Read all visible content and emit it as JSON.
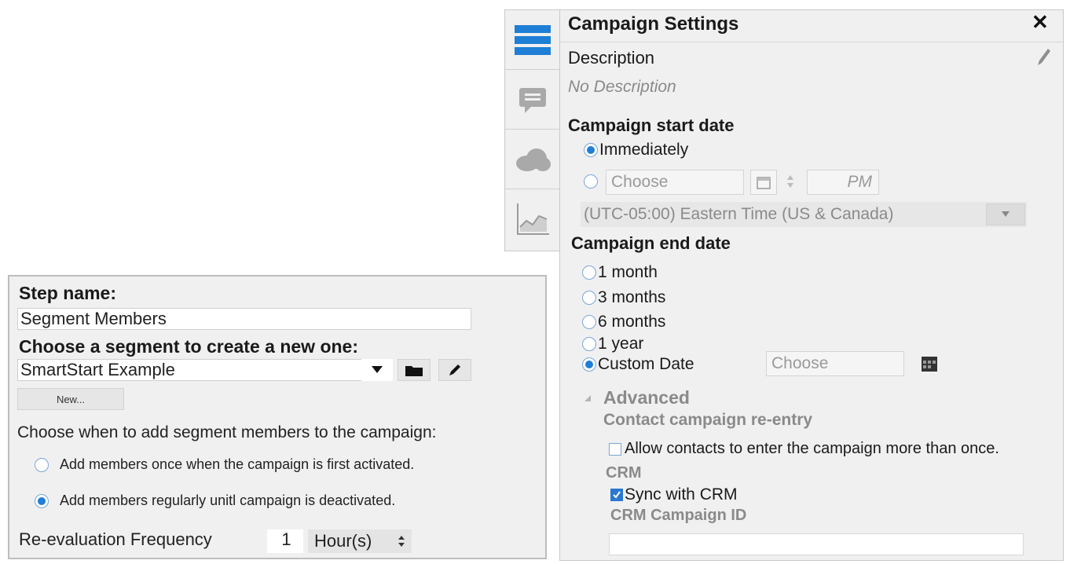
{
  "segment_step": {
    "step_name_label": "Step name:",
    "step_name_value": "Segment Members",
    "segment_label": "Choose a segment to create a new one:",
    "segment_value": "SmartStart Example",
    "new_button": "New...",
    "when_label": "Choose when to add segment members to the campaign:",
    "options": [
      {
        "label": "Add members once when the campaign is first activated.",
        "selected": false
      },
      {
        "label": "Add members regularly unitl campaign is deactivated.",
        "selected": true
      }
    ],
    "frequency_label": "Re-evaluation Frequency",
    "frequency_value": "1",
    "frequency_unit": "Hour(s)"
  },
  "campaign_settings": {
    "title": "Campaign Settings",
    "close_glyph": "✕",
    "description_label": "Description",
    "description_value": "No Description",
    "start_date": {
      "heading": "Campaign start date",
      "immediately": "Immediately",
      "choose_placeholder": "Choose",
      "ampm": "PM",
      "timezone": "(UTC-05:00) Eastern Time (US & Canada)",
      "selected": "Immediately"
    },
    "end_date": {
      "heading": "Campaign end date",
      "options": [
        "1 month",
        "3 months",
        "6 months",
        "1 year",
        "Custom Date"
      ],
      "selected": "Custom Date",
      "custom_placeholder": "Choose"
    },
    "advanced": {
      "heading": "Advanced",
      "reentry_heading": "Contact campaign re-entry",
      "reentry_option": "Allow contacts to enter the campaign more than once.",
      "reentry_checked": false,
      "crm_heading": "CRM",
      "sync_label": "Sync with CRM",
      "sync_checked": true,
      "crm_id_label": "CRM Campaign ID",
      "crm_id_value": ""
    }
  },
  "side_tabs": [
    "settings-list-icon",
    "comment-icon",
    "cloud-icon",
    "chart-icon"
  ],
  "colors": {
    "accent": "#1f7fd6",
    "panel_bg": "#f0f0f0",
    "muted_text": "#8a8a8a"
  }
}
